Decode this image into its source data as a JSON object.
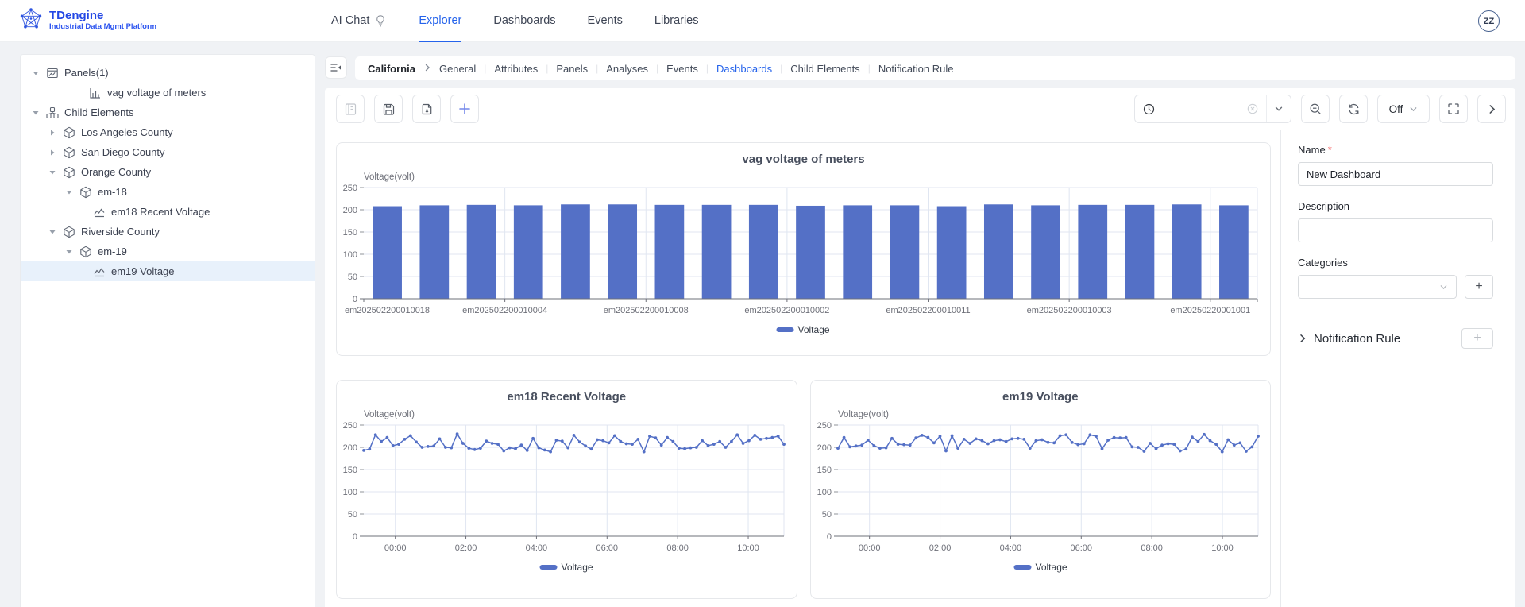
{
  "brand": {
    "title": "TDengine",
    "subtitle": "Industrial Data Mgmt Platform"
  },
  "nav": {
    "items": [
      "AI Chat",
      "Explorer",
      "Dashboards",
      "Events",
      "Libraries"
    ],
    "active": "Explorer",
    "avatar_initials": "ZZ"
  },
  "tree": [
    {
      "label": "Panels(1)",
      "icon": "panels-icon",
      "level": 0,
      "expand": "open"
    },
    {
      "label": "vag voltage of meters",
      "icon": "bar-chart-icon",
      "level": 1,
      "expand": null
    },
    {
      "label": "Child Elements",
      "icon": "cluster-icon",
      "level": 0,
      "expand": "open"
    },
    {
      "label": "Los Angeles County",
      "icon": "cube-icon",
      "level": 1,
      "expand": "closed"
    },
    {
      "label": "San Diego County",
      "icon": "cube-icon",
      "level": 1,
      "expand": "closed"
    },
    {
      "label": "Orange County",
      "icon": "cube-icon",
      "level": 1,
      "expand": "open"
    },
    {
      "label": "em-18",
      "icon": "cube-icon",
      "level": 2,
      "expand": "open"
    },
    {
      "label": "em18 Recent Voltage",
      "icon": "line-chart-icon",
      "level": 3,
      "expand": null
    },
    {
      "label": "Riverside County",
      "icon": "cube-icon",
      "level": 1,
      "expand": "open"
    },
    {
      "label": "em-19",
      "icon": "cube-icon",
      "level": 2,
      "expand": "open"
    },
    {
      "label": "em19 Voltage",
      "icon": "line-chart-icon",
      "level": 3,
      "expand": null,
      "selected": true
    }
  ],
  "breadcrumb": {
    "root": "California",
    "tabs": [
      "General",
      "Attributes",
      "Panels",
      "Analyses",
      "Events",
      "Dashboards",
      "Child Elements",
      "Notification Rule"
    ],
    "active": "Dashboards"
  },
  "toolbar": {
    "off_label": "Off",
    "time_value": ""
  },
  "inspector": {
    "name_label": "Name",
    "required_mark": "*",
    "name_value": "New Dashboard",
    "description_label": "Description",
    "description_value": "",
    "categories_label": "Categories",
    "categories_value": "",
    "notification_rule_label": "Notification Rule",
    "plus_glyph": "+"
  },
  "chart_data": [
    {
      "type": "bar",
      "title": "vag voltage of meters",
      "ylabel": "Voltage(volt)",
      "yticks": [
        0,
        50,
        100,
        150,
        200,
        250
      ],
      "ylim": [
        0,
        250
      ],
      "legend": "Voltage",
      "legend_position": "bottom",
      "grid": true,
      "color": "#5470C6",
      "categories": [
        "em202502200010018",
        "em202502200010004",
        "em202502200010008",
        "em202502200010002",
        "em202502200010011",
        "em202502200010003",
        "em20250220001001"
      ],
      "category_interval": 3,
      "values": [
        208,
        210,
        211,
        210,
        212,
        212,
        211,
        211,
        211,
        209,
        210,
        210,
        208,
        212,
        210,
        211,
        211,
        212,
        210
      ]
    },
    {
      "type": "line",
      "title": "em18 Recent Voltage",
      "ylabel": "Voltage(volt)",
      "yticks": [
        0,
        50,
        100,
        150,
        200,
        250
      ],
      "ylim": [
        0,
        250
      ],
      "legend": "Voltage",
      "legend_position": "bottom",
      "grid": true,
      "color": "#5470C6",
      "xticks": [
        "00:00",
        "02:00",
        "04:00",
        "06:00",
        "08:00",
        "10:00"
      ],
      "values": [
        193,
        196,
        228,
        213,
        222,
        204,
        207,
        218,
        226,
        212,
        200,
        202,
        203,
        219,
        200,
        199,
        230,
        209,
        198,
        195,
        198,
        214,
        209,
        207,
        192,
        199,
        197,
        205,
        193,
        220,
        199,
        194,
        190,
        216,
        214,
        199,
        227,
        212,
        203,
        196,
        217,
        215,
        210,
        226,
        213,
        208,
        207,
        218,
        190,
        225,
        221,
        205,
        222,
        213,
        198,
        197,
        199,
        200,
        215,
        204,
        207,
        213,
        200,
        213,
        228,
        209,
        215,
        227,
        218,
        220,
        222,
        225,
        207
      ]
    },
    {
      "type": "line",
      "title": "em19 Voltage",
      "ylabel": "Voltage(volt)",
      "yticks": [
        0,
        50,
        100,
        150,
        200,
        250
      ],
      "ylim": [
        0,
        250
      ],
      "legend": "Voltage",
      "legend_position": "bottom",
      "grid": true,
      "color": "#5470C6",
      "xticks": [
        "00:00",
        "02:00",
        "04:00",
        "06:00",
        "08:00",
        "10:00"
      ],
      "values": [
        198,
        222,
        201,
        203,
        205,
        216,
        204,
        198,
        199,
        220,
        207,
        206,
        205,
        221,
        227,
        222,
        210,
        225,
        192,
        226,
        198,
        218,
        209,
        219,
        215,
        208,
        215,
        217,
        213,
        219,
        220,
        218,
        198,
        215,
        217,
        211,
        210,
        226,
        228,
        211,
        206,
        208,
        228,
        225,
        197,
        216,
        222,
        221,
        222,
        201,
        200,
        191,
        209,
        197,
        205,
        208,
        207,
        192,
        196,
        223,
        213,
        229,
        215,
        207,
        190,
        217,
        205,
        210,
        191,
        201,
        225
      ]
    }
  ]
}
